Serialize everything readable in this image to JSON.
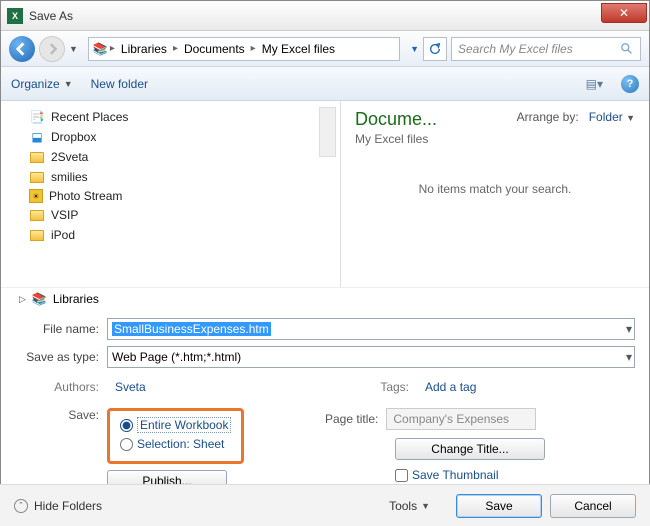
{
  "window": {
    "title": "Save As",
    "close_x": "✕"
  },
  "nav": {
    "crumbs": [
      "Libraries",
      "Documents",
      "My Excel files"
    ],
    "search_placeholder": "Search My Excel files"
  },
  "toolbar": {
    "organize": "Organize",
    "new_folder": "New folder"
  },
  "tree": {
    "items": [
      {
        "label": "Recent Places",
        "icon": "recent"
      },
      {
        "label": "Dropbox",
        "icon": "dropbox"
      },
      {
        "label": "2Sveta",
        "icon": "folder"
      },
      {
        "label": "smilies",
        "icon": "folder"
      },
      {
        "label": "Photo Stream",
        "icon": "photo"
      },
      {
        "label": "VSIP",
        "icon": "folder"
      },
      {
        "label": "iPod",
        "icon": "folder"
      }
    ],
    "libraries_label": "Libraries"
  },
  "preview": {
    "heading": "Docume...",
    "subheading": "My Excel files",
    "arrange_label": "Arrange by:",
    "arrange_value": "Folder",
    "empty_msg": "No items match your search."
  },
  "form": {
    "filename_label": "File name:",
    "filename_value": "SmallBusinessExpenses.htm",
    "type_label": "Save as type:",
    "type_value": "Web Page (*.htm;*.html)",
    "authors_label": "Authors:",
    "authors_value": "Sveta",
    "tags_label": "Tags:",
    "tags_value": "Add a tag"
  },
  "save_options": {
    "label": "Save:",
    "opt1": "Entire Workbook",
    "opt2": "Selection: Sheet",
    "publish": "Publish..."
  },
  "page_title": {
    "label": "Page title:",
    "value": "Company's Expenses",
    "change": "Change Title...",
    "thumbnail": "Save Thumbnail"
  },
  "footer": {
    "hide": "Hide Folders",
    "tools": "Tools",
    "save": "Save",
    "cancel": "Cancel"
  }
}
